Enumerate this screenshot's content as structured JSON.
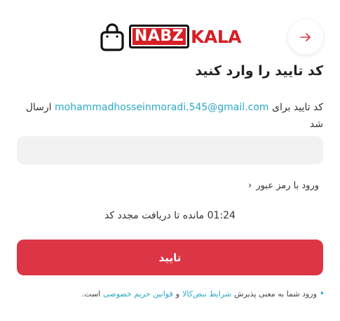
{
  "header": {
    "back_icon": "arrow-right-icon",
    "logo": {
      "bag_icon": "shopping-bag-icon",
      "brand_part_1": "NABZ",
      "brand_part_2": "KALA",
      "brand_color": "#d71f26"
    }
  },
  "form": {
    "title": "کد تایید را وارد کنید",
    "info_prefix": "کد تایید برای",
    "email": "mohammadhosseinmoradi.545@gmail.com",
    "info_suffix": "ارسال شد",
    "otp_value": "",
    "password_login_label": "ورود با رمز عبور",
    "timer_value": "01:24",
    "timer_text": "مانده تا دریافت مجدد کد",
    "confirm_label": "تایید",
    "accent_color": "#dc3545"
  },
  "terms": {
    "prefix": "ورود شما به معنی پذیرش",
    "link_terms": "شرایط نبض‌کالا",
    "and": "و",
    "link_privacy": "قوانین حریم خصوصی",
    "suffix": "است."
  }
}
